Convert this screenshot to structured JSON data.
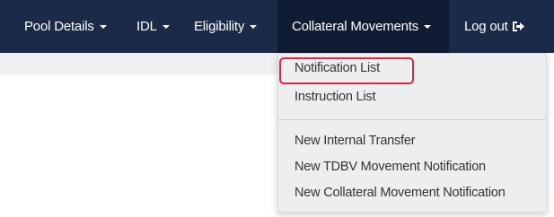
{
  "navbar": {
    "items": [
      {
        "label": "Pool Details"
      },
      {
        "label": "IDL"
      },
      {
        "label": "Eligibility"
      },
      {
        "label": "Collateral Movements"
      },
      {
        "label": "Log out"
      }
    ],
    "logout_icon": "sign-out-icon",
    "active_item": "Collateral Movements"
  },
  "dropdown": {
    "items": [
      {
        "label": "Notification List",
        "highlighted": true
      },
      {
        "label": "Instruction List"
      },
      {
        "label": "New Internal Transfer"
      },
      {
        "label": "New TDBV Movement Notification"
      },
      {
        "label": "New Collateral Movement Notification"
      }
    ]
  },
  "colors": {
    "navbar_bg": "#1b2a47",
    "dropdown_bg": "#eceef0",
    "highlight_border": "#e0263a"
  }
}
